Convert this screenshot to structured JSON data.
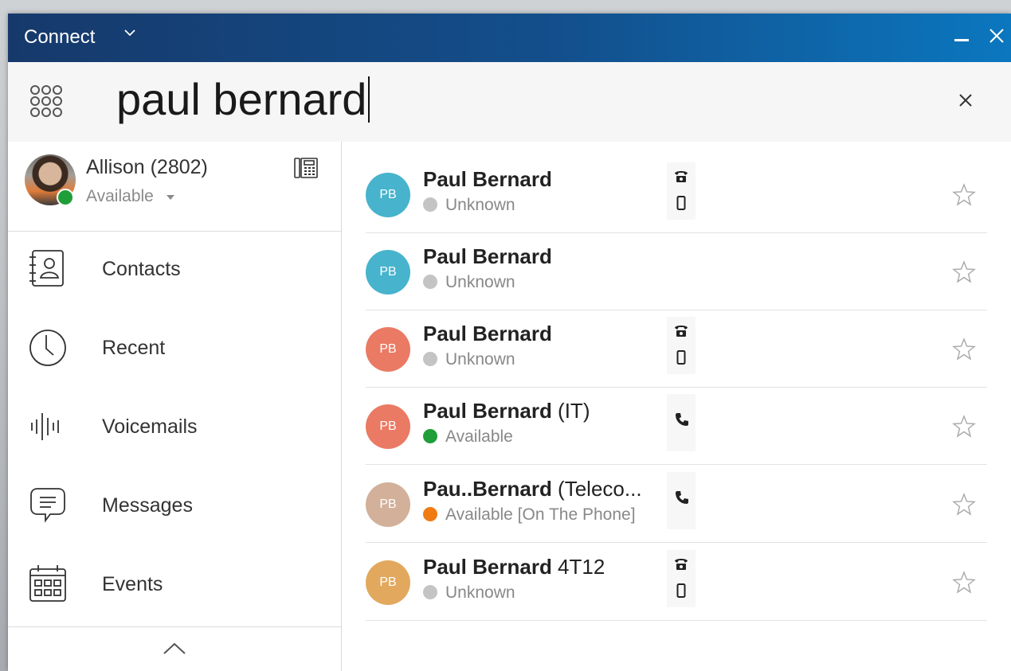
{
  "window": {
    "title": "Connect",
    "colors": {
      "titlebar_start": "#16396b",
      "titlebar_end": "#0b77bf"
    }
  },
  "search": {
    "value": "paul bernard"
  },
  "profile": {
    "name": "Allison (2802)",
    "status": "Available",
    "status_color": "#1f9e3a"
  },
  "nav": {
    "items": [
      {
        "label": "Contacts",
        "icon": "contacts-book-icon"
      },
      {
        "label": "Recent",
        "icon": "clock-icon"
      },
      {
        "label": "Voicemails",
        "icon": "voicemail-waveform-icon"
      },
      {
        "label": "Messages",
        "icon": "chat-bubble-icon"
      },
      {
        "label": "Events",
        "icon": "calendar-icon"
      }
    ]
  },
  "results": [
    {
      "initials": "PB",
      "avatar_color": "#47b3cc",
      "name": "Paul Bernard",
      "suffix": "",
      "status": "Unknown",
      "status_color": "#c4c4c4",
      "phones": [
        "desk-phone-icon",
        "mobile-phone-icon"
      ]
    },
    {
      "initials": "PB",
      "avatar_color": "#47b3cc",
      "name": "Paul Bernard",
      "suffix": "",
      "status": "Unknown",
      "status_color": "#c4c4c4",
      "phones": []
    },
    {
      "initials": "PB",
      "avatar_color": "#ea7a64",
      "name": "Paul Bernard",
      "suffix": "",
      "status": "Unknown",
      "status_color": "#c4c4c4",
      "phones": [
        "desk-phone-icon",
        "mobile-phone-icon"
      ]
    },
    {
      "initials": "PB",
      "avatar_color": "#ea7a64",
      "name": "Paul Bernard",
      "suffix": " (IT)",
      "status": "Available",
      "status_color": "#1f9e3a",
      "phones": [
        "call-icon"
      ]
    },
    {
      "initials": "PB",
      "avatar_color": "#d2b09a",
      "name": "Pau..Bernard",
      "suffix": " (Teleco...",
      "status": "Available [On The Phone]",
      "status_color": "#f07b12",
      "phones": [
        "call-icon"
      ]
    },
    {
      "initials": "PB",
      "avatar_color": "#e2a85e",
      "name": "Paul Bernard",
      "suffix": " 4T12",
      "status": "Unknown",
      "status_color": "#c4c4c4",
      "phones": [
        "desk-phone-icon",
        "mobile-phone-icon"
      ]
    }
  ]
}
